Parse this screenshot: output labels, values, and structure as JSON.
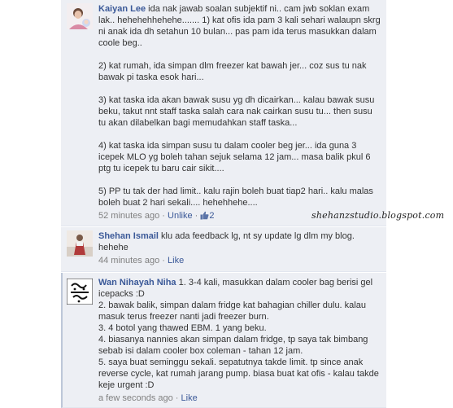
{
  "comments": [
    {
      "author": "Kaiyan Lee",
      "text": " ida nak jawab soalan subjektif ni.. cam jwb soklan exam lak.. hehehehhehehe....... 1) kat ofis ida pam 3 kali sehari walaupn skrg ni anak ida dh setahun 10 bulan... pas pam ida terus masukkan dalam coole beg..\n\n2) kat rumah, ida simpan dlm freezer kat bawah jer... coz sus tu nak bawak pi taska esok hari...\n\n3) kat taska ida akan bawak susu yg dh dicairkan... kalau bawak susu beku, takut nnt staff taska salah cara nak cairkan susu tu... then susu tu akan dilabelkan bagi memudahkan staff taska...\n\n4) kat taska ida simpan susu tu dalam cooler beg jer... ida guna 3 icepek MLO yg boleh tahan sejuk selama 12 jam... masa balik pkul 6 ptg tu icepek tu baru cair sikit....\n\n5) PP tu tak der had limit.. kalu rajin boleh buat tiap2 hari.. kalu malas boleh buat 2 hari sekali.... hehehhehe....",
      "time": "52 minutes ago",
      "action": "Unlike",
      "likes": "2"
    },
    {
      "author": "Shehan Ismail",
      "text": " klu ada feedback lg, nt sy update lg dlm my blog. hehehe",
      "time": "44 minutes ago",
      "action": "Like"
    },
    {
      "author": "Wan Nihayah Niha",
      "text": " 1. 3-4 kali, masukkan dalam cooler bag berisi gel icepacks :D\n2. bawak balik, simpan dalam fridge kat bahagian chiller dulu. kalau masuk terus freezer nanti jadi freezer burn.\n3. 4 botol yang thawed EBM. 1 yang beku.\n4. biasanya nannies akan simpan dalam fridge, tp saya tak bimbang sebab isi dalam cooler box coleman - tahan 12 jam.\n5. saya buat seminggu sekali. sepatutnya takde limit. tp since anak reverse cycle, kat rumah jarang pump. biasa buat kat ofis - kalau takde keje urgent :D",
      "time": "a few seconds ago",
      "action": "Like"
    }
  ],
  "separator": "·",
  "watermark": "shehanzstudio.blogspot.com"
}
